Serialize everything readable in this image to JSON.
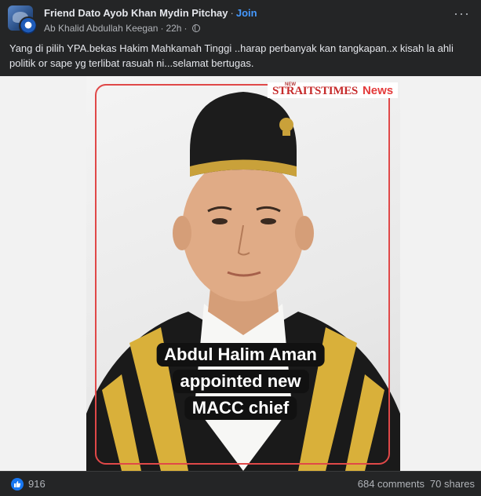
{
  "post": {
    "author": "Friend Dato Ayob Khan Mydin Pitchay",
    "separator": "·",
    "join_label": "Join",
    "poster": "Ab Khalid Abdullah Keegan",
    "time": "22h",
    "caption": "Yang di pilih YPA.bekas Hakim Mahkamah Tinggi ..harap perbanyak kan tangkapan..x kisah la ahli politik or sape yg terlibat rasuah ni...selamat bertugas."
  },
  "media": {
    "brand_small": "NEW",
    "brand_main": "STRAITSTIMES",
    "brand_news": "News",
    "overlay_lines": [
      "Abdul Halim Aman",
      "appointed new",
      "MACC chief"
    ]
  },
  "footer": {
    "reaction_count": "916",
    "comments": "684 comments",
    "shares": "70 shares"
  },
  "colors": {
    "background": "#242526",
    "accent": "#4599ff",
    "like_blue": "#1877f2",
    "frame_red": "#e04848"
  },
  "icons": [
    "group-avatar-icon",
    "user-avatar-icon",
    "globe-icon",
    "more-options-icon",
    "like-reaction-icon"
  ]
}
